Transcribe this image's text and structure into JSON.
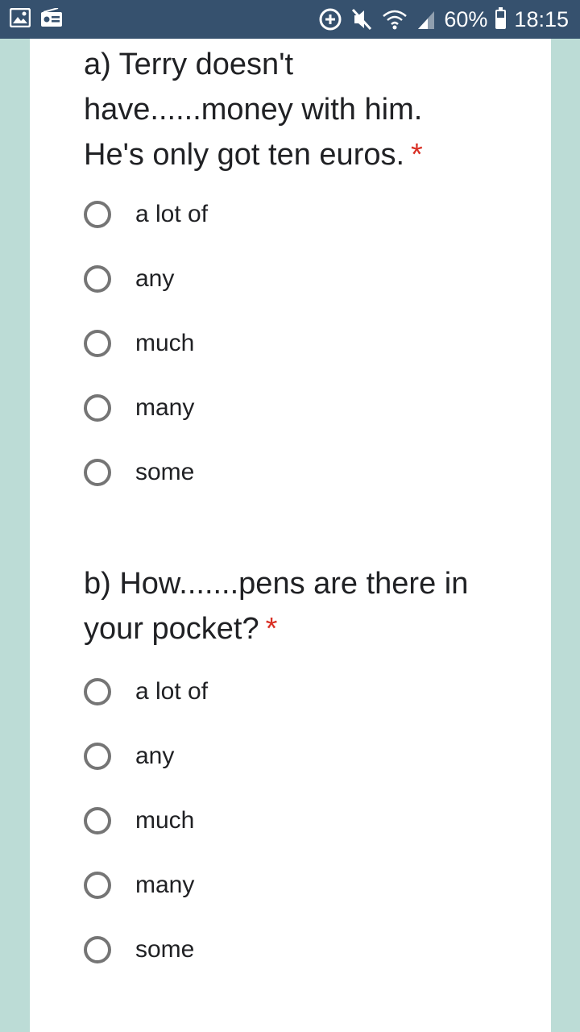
{
  "status_bar": {
    "battery": "60%",
    "time": "18:15",
    "battery_level": 0.6
  },
  "questions": [
    {
      "title_lines": [
        "a) Terry doesn't",
        "have......money with him.",
        "He's only got ten euros."
      ],
      "required_mark": "*",
      "options": [
        "a lot of",
        "any",
        "much",
        "many",
        "some"
      ]
    },
    {
      "title_lines": [
        "b) How.......pens are there in",
        "your pocket?"
      ],
      "required_mark": "*",
      "options": [
        "a lot of",
        "any",
        "much",
        "many",
        "some"
      ]
    }
  ]
}
